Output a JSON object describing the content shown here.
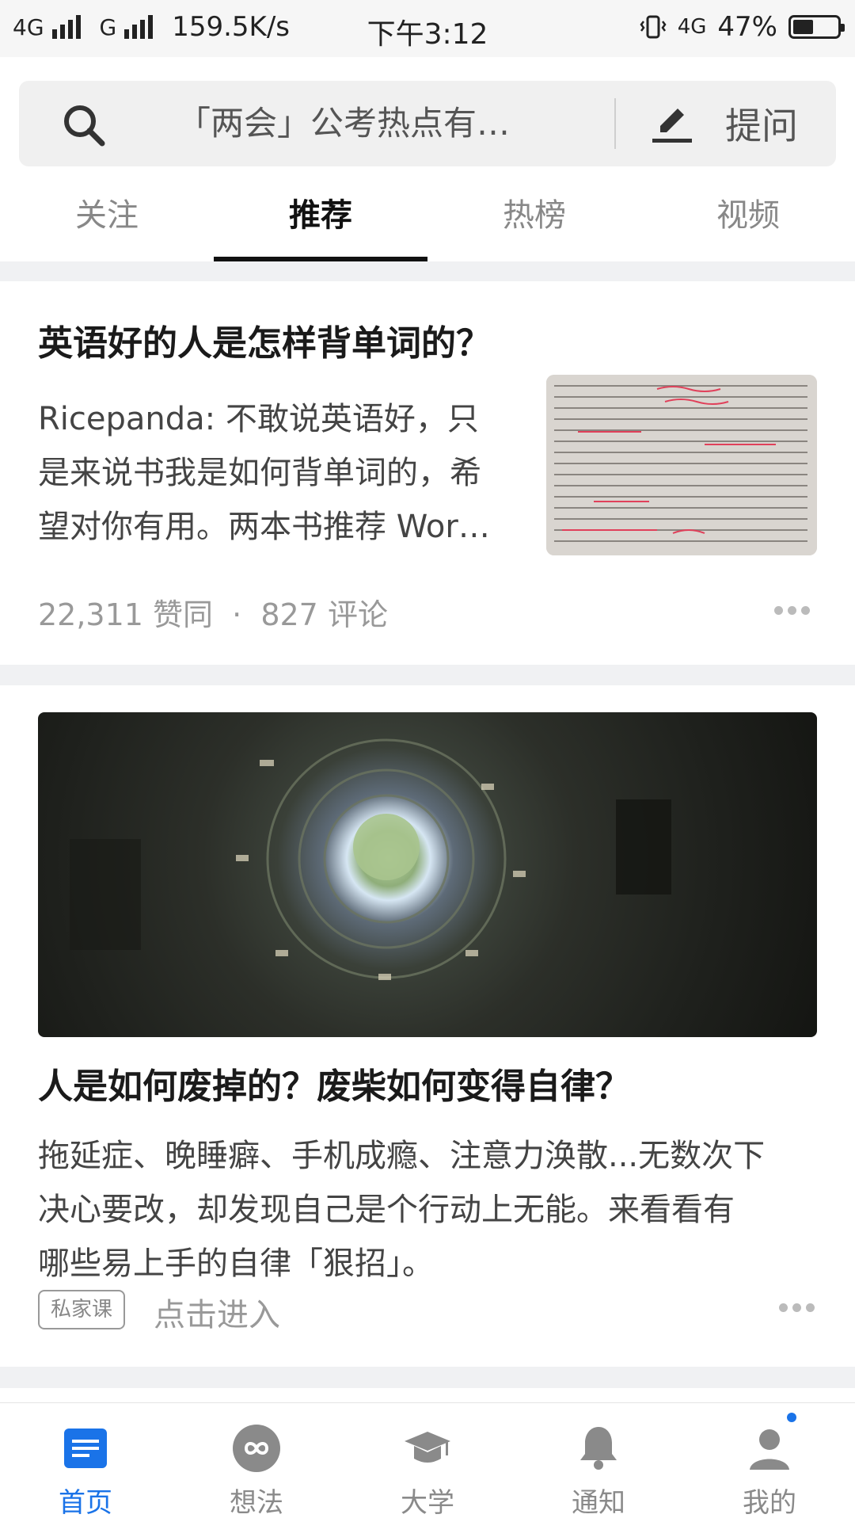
{
  "status_bar": {
    "network1": "4G",
    "network2": "G",
    "speed": "159.5K/s",
    "time": "下午3:12",
    "network_right": "4G",
    "battery": "47%",
    "battery_level": 0.47
  },
  "search": {
    "placeholder": "「两会」公考热点有…",
    "ask_label": "提问"
  },
  "tabs": [
    {
      "label": "关注"
    },
    {
      "label": "推荐",
      "active": true
    },
    {
      "label": "热榜"
    },
    {
      "label": "视频"
    }
  ],
  "feed": [
    {
      "title": "英语好的人是怎样背单词的？",
      "excerpt_lines": [
        "Ricepanda: 不敢说英语好，只",
        "是来说书我是如何背单词的，希",
        "望对你有用。两本书推荐 Wor…"
      ],
      "likes": "22,311 赞同",
      "separator": "·",
      "comments": "827 评论",
      "thumbnail_icon": "textbook-photo"
    },
    {
      "image_icon": "spiral-well-photo",
      "title": "人是如何废掉的？废柴如何变得自律？",
      "excerpt_lines": [
        "拖延症、晚睡癖、手机成瘾、注意力涣散...无数次下",
        "决心要改，却发现自己是个行动上无能。来看看有",
        "哪些易上手的自律「狠招」。"
      ],
      "tag": "私家课",
      "action": "点击进入"
    }
  ],
  "bottom_nav": [
    {
      "label": "首页",
      "icon": "home-icon",
      "active": true
    },
    {
      "label": "想法",
      "icon": "infinity-icon"
    },
    {
      "label": "大学",
      "icon": "graduation-cap-icon"
    },
    {
      "label": "通知",
      "icon": "bell-icon"
    },
    {
      "label": "我的",
      "icon": "profile-icon",
      "badge": true
    }
  ],
  "colors": {
    "accent": "#1a73e8",
    "text_primary": "#1a1a1a",
    "text_secondary": "#999999"
  }
}
